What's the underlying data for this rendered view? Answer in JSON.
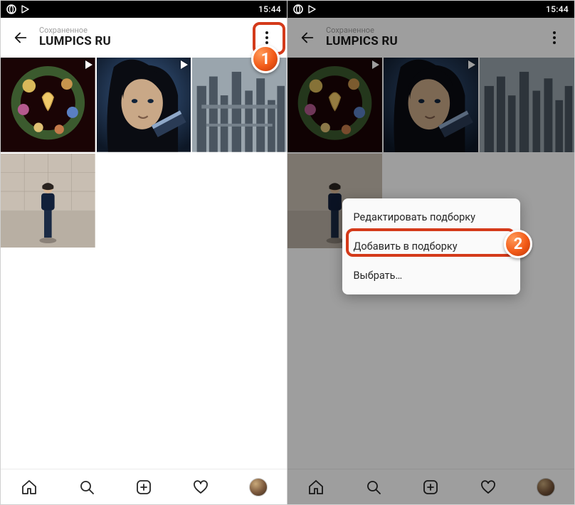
{
  "left": {
    "status": {
      "time": "15:44"
    },
    "header": {
      "subtitle": "Сохраненное",
      "title": "LUMPICS RU"
    },
    "grid": [
      {
        "id": "wreath",
        "has_play": true
      },
      {
        "id": "face",
        "has_play": true
      },
      {
        "id": "city",
        "has_play": false
      },
      {
        "id": "wall",
        "has_play": false
      }
    ],
    "callout": {
      "number": "1"
    }
  },
  "right": {
    "status": {
      "time": "15:44"
    },
    "header": {
      "subtitle": "Сохраненное",
      "title": "LUMPICS RU"
    },
    "popup": {
      "edit": "Редактировать подборку",
      "add": "Добавить в подборку",
      "select": "Выбрать…"
    },
    "callout": {
      "number": "2"
    }
  },
  "nav": {
    "items": [
      "home",
      "search",
      "add",
      "activity",
      "profile"
    ]
  }
}
